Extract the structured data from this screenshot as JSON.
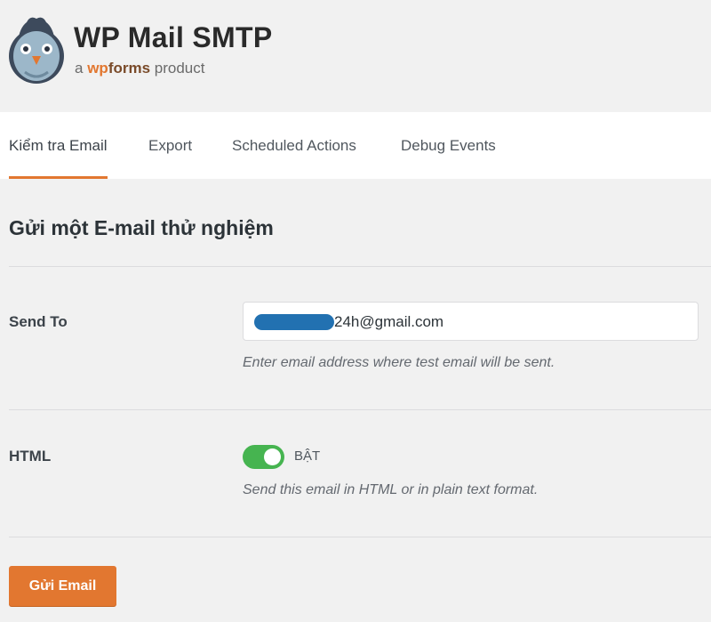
{
  "brand": {
    "title": "WP Mail SMTP",
    "sub_prefix": "a",
    "sub_wp": "wp",
    "sub_forms": "forms",
    "sub_suffix": "product"
  },
  "tabs": [
    {
      "label": "Kiểm tra Email",
      "active": true
    },
    {
      "label": "Export",
      "active": false
    },
    {
      "label": "Scheduled Actions",
      "active": false
    },
    {
      "label": "Debug Events",
      "active": false
    }
  ],
  "section": {
    "title": "Gửi một E-mail thử nghiệm"
  },
  "send_to": {
    "label": "Send To",
    "value": "24h@gmail.com",
    "help": "Enter email address where test email will be sent."
  },
  "html": {
    "label": "HTML",
    "toggle_state": "BẬT",
    "help": "Send this email in HTML or in plain text format."
  },
  "submit_label": "Gửi Email",
  "colors": {
    "accent": "#e27730",
    "toggle_on": "#46b450",
    "redaction": "#2271b1"
  }
}
